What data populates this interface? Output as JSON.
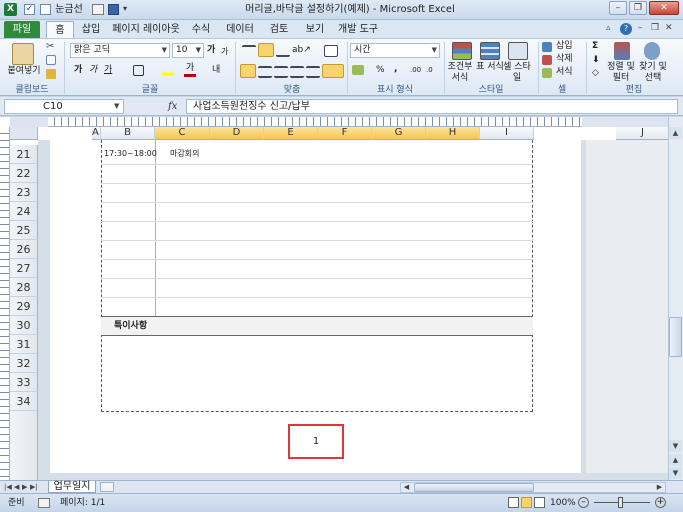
{
  "window": {
    "title": "머리글,바닥글 설정하기(예제) - Microsoft Excel",
    "qat_gridlines": "눈금선"
  },
  "ribbon_tabs": [
    "파일",
    "홈",
    "삽입",
    "페이지 레이아웃",
    "수식",
    "데이터",
    "검토",
    "보기",
    "개발 도구"
  ],
  "ribbon": {
    "paste_label": "붙여넣기",
    "font_name": "맑은 고딕",
    "font_size": "10",
    "number_format": "시간",
    "groups": [
      "클립보드",
      "글꼴",
      "맞춤",
      "표시 형식",
      "스타일",
      "셀",
      "편집"
    ],
    "style_buttons": [
      "조건부 서식",
      "표 서식",
      "셀 스타일"
    ],
    "cell_buttons": [
      "삽입",
      "삭제",
      "서식"
    ],
    "edit_buttons": [
      "정렬 및 필터",
      "찾기 및 선택"
    ]
  },
  "formula_bar": {
    "cell_ref": "C10",
    "fx": "fx",
    "content": "사업소득원천징수 신고/납부"
  },
  "columns": [
    "A",
    "B",
    "C",
    "D",
    "E",
    "F",
    "G",
    "H",
    "I",
    "J"
  ],
  "rows": [
    "21",
    "22",
    "23",
    "24",
    "25",
    "26",
    "27",
    "28",
    "29",
    "30",
    "31",
    "32",
    "33",
    "34"
  ],
  "cells": {
    "time": "17:30~18:00",
    "task": "마감회의",
    "special_notes": "특이사항"
  },
  "footer": {
    "page_number": "1"
  },
  "sheet_tabs": [
    "업무일지"
  ],
  "status": {
    "mode": "준비",
    "page": "페이지: 1/1",
    "zoom": "100%"
  }
}
